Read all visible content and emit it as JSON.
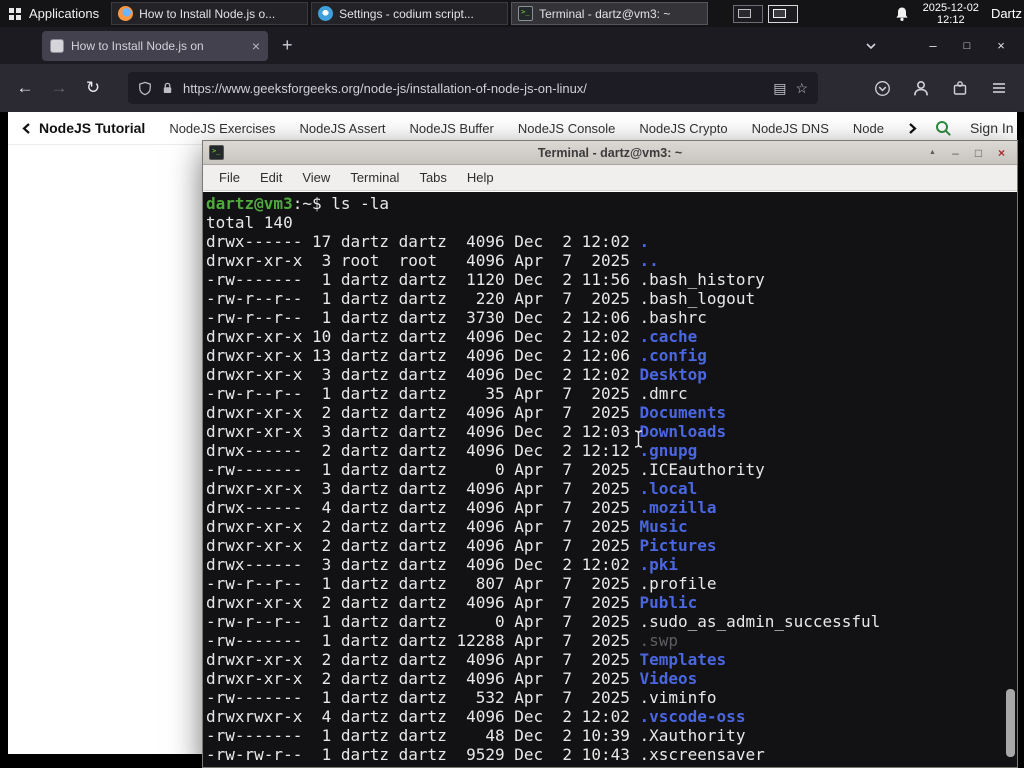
{
  "panel": {
    "applications": "Applications",
    "taskbar": [
      {
        "title": "How to Install Node.js o...",
        "app": "firefox"
      },
      {
        "title": "Settings - codium script...",
        "app": "codium"
      },
      {
        "title": "Terminal - dartz@vm3: ~",
        "app": "terminal"
      }
    ],
    "date": "2025-12-02",
    "time": "12:12",
    "user": "Dartz"
  },
  "browser": {
    "tab_title": "How to Install Node.js on",
    "url": "https://www.geeksforgeeks.org/node-js/installation-of-node-js-on-linux/"
  },
  "gfg_nav": {
    "items": [
      "NodeJS Tutorial",
      "NodeJS Exercises",
      "NodeJS Assert",
      "NodeJS Buffer",
      "NodeJS Console",
      "NodeJS Crypto",
      "NodeJS DNS",
      "Node"
    ],
    "sign_in": "Sign In"
  },
  "terminal": {
    "title": "Terminal - dartz@vm3: ~",
    "menu": [
      "File",
      "Edit",
      "View",
      "Terminal",
      "Tabs",
      "Help"
    ],
    "prompt": "dartz@vm3",
    "prompt_suffix": ":~$",
    "command": " ls -la",
    "total": "total 140",
    "listing": [
      {
        "pre": "drwx------ 17 dartz dartz  4096 Dec  2 12:02 ",
        "name": ".",
        "type": "dir"
      },
      {
        "pre": "drwxr-xr-x  3 root  root   4096 Apr  7  2025 ",
        "name": "..",
        "type": "dir"
      },
      {
        "pre": "-rw-------  1 dartz dartz  1120 Dec  2 11:56 ",
        "name": ".bash_history",
        "type": "file"
      },
      {
        "pre": "-rw-r--r--  1 dartz dartz   220 Apr  7  2025 ",
        "name": ".bash_logout",
        "type": "file"
      },
      {
        "pre": "-rw-r--r--  1 dartz dartz  3730 Dec  2 12:06 ",
        "name": ".bashrc",
        "type": "file"
      },
      {
        "pre": "drwxr-xr-x 10 dartz dartz  4096 Dec  2 12:02 ",
        "name": ".cache",
        "type": "dir"
      },
      {
        "pre": "drwxr-xr-x 13 dartz dartz  4096 Dec  2 12:06 ",
        "name": ".config",
        "type": "dir"
      },
      {
        "pre": "drwxr-xr-x  3 dartz dartz  4096 Dec  2 12:02 ",
        "name": "Desktop",
        "type": "dir"
      },
      {
        "pre": "-rw-r--r--  1 dartz dartz    35 Apr  7  2025 ",
        "name": ".dmrc",
        "type": "file"
      },
      {
        "pre": "drwxr-xr-x  2 dartz dartz  4096 Apr  7  2025 ",
        "name": "Documents",
        "type": "dir"
      },
      {
        "pre": "drwxr-xr-x  3 dartz dartz  4096 Dec  2 12:03 ",
        "name": "Downloads",
        "type": "dir"
      },
      {
        "pre": "drwx------  2 dartz dartz  4096 Dec  2 12:12 ",
        "name": ".gnupg",
        "type": "dir"
      },
      {
        "pre": "-rw-------  1 dartz dartz     0 Apr  7  2025 ",
        "name": ".ICEauthority",
        "type": "file"
      },
      {
        "pre": "drwxr-xr-x  3 dartz dartz  4096 Apr  7  2025 ",
        "name": ".local",
        "type": "dir"
      },
      {
        "pre": "drwx------  4 dartz dartz  4096 Apr  7  2025 ",
        "name": ".mozilla",
        "type": "dir"
      },
      {
        "pre": "drwxr-xr-x  2 dartz dartz  4096 Apr  7  2025 ",
        "name": "Music",
        "type": "dir"
      },
      {
        "pre": "drwxr-xr-x  2 dartz dartz  4096 Apr  7  2025 ",
        "name": "Pictures",
        "type": "dir"
      },
      {
        "pre": "drwx------  3 dartz dartz  4096 Dec  2 12:02 ",
        "name": ".pki",
        "type": "dir"
      },
      {
        "pre": "-rw-r--r--  1 dartz dartz   807 Apr  7  2025 ",
        "name": ".profile",
        "type": "file"
      },
      {
        "pre": "drwxr-xr-x  2 dartz dartz  4096 Apr  7  2025 ",
        "name": "Public",
        "type": "dir"
      },
      {
        "pre": "-rw-r--r--  1 dartz dartz     0 Apr  7  2025 ",
        "name": ".sudo_as_admin_successful",
        "type": "file"
      },
      {
        "pre": "-rw-------  1 dartz dartz 12288 Apr  7  2025 ",
        "name": ".swp",
        "type": "dim"
      },
      {
        "pre": "drwxr-xr-x  2 dartz dartz  4096 Apr  7  2025 ",
        "name": "Templates",
        "type": "dir"
      },
      {
        "pre": "drwxr-xr-x  2 dartz dartz  4096 Apr  7  2025 ",
        "name": "Videos",
        "type": "dir"
      },
      {
        "pre": "-rw-------  1 dartz dartz   532 Apr  7  2025 ",
        "name": ".viminfo",
        "type": "file"
      },
      {
        "pre": "drwxrwxr-x  4 dartz dartz  4096 Dec  2 12:02 ",
        "name": ".vscode-oss",
        "type": "dir"
      },
      {
        "pre": "-rw-------  1 dartz dartz    48 Dec  2 10:39 ",
        "name": ".Xauthority",
        "type": "file"
      },
      {
        "pre": "-rw-rw-r--  1 dartz dartz  9529 Dec  2 10:43 ",
        "name": ".xscreensaver",
        "type": "file"
      }
    ]
  },
  "icons": {
    "plus": "+",
    "minimize": "–",
    "maximize": "□",
    "close": "×",
    "shade": "▲",
    "reader": "▤",
    "star": "☆",
    "back": "←",
    "forward": "→",
    "reload": "↻"
  },
  "colors": {
    "gfg_green": "#2f8d46",
    "dir_blue": "#4a66e0",
    "prompt_green": "#4faa3c",
    "terminal_bg": "#121214",
    "browser_toolbar": "#2b2a33"
  }
}
